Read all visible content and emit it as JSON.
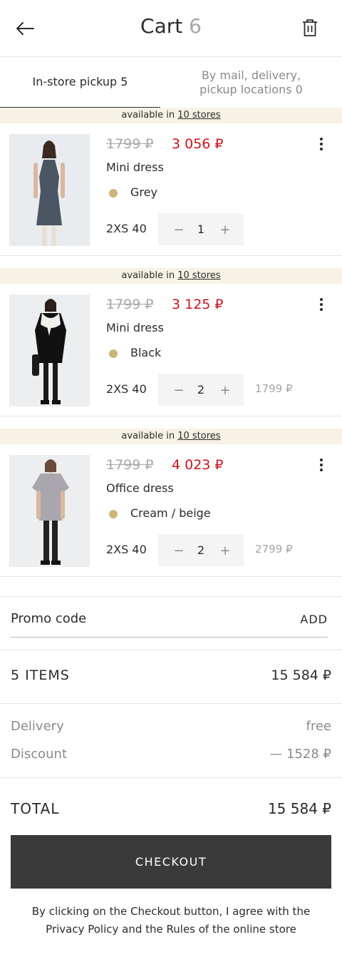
{
  "header": {
    "title": "Cart",
    "count": "6"
  },
  "tabs": [
    {
      "label": "In-store pickup 5"
    },
    {
      "label": "By mail, delivery, pickup locations 0"
    }
  ],
  "store_strip": {
    "prefix": "available in",
    "link": "10 stores"
  },
  "items": [
    {
      "old_price": "1799 ₽",
      "new_price": "3 056 ₽",
      "name": "Mini dress",
      "color": "Grey",
      "size": "2XS 40",
      "quantity": "1",
      "unit_price": ""
    },
    {
      "old_price": "1799 ₽",
      "new_price": "3 125 ₽",
      "name": "Mini dress",
      "color": "Black",
      "size": "2XS 40",
      "quantity": "2",
      "unit_price": "1799 ₽"
    },
    {
      "old_price": "1799 ₽",
      "new_price": "4 023 ₽",
      "name": "Office dress",
      "color": "Cream / beige",
      "size": "2XS 40",
      "quantity": "2",
      "unit_price": "2799 ₽"
    }
  ],
  "stepper": {
    "minus": "−",
    "plus": "+"
  },
  "promo": {
    "label": "Promo code",
    "add": "ADD"
  },
  "summary": {
    "items_label": "5 ITEMS",
    "items_value": "15 584 ₽",
    "delivery_label": "Delivery",
    "delivery_value": "free",
    "discount_label": "Discount",
    "discount_value": "— 1528 ₽",
    "total_label": "TOTAL",
    "total_value": "15 584 ₽"
  },
  "checkout": {
    "label": "CHECKOUT",
    "agreement": "By clicking on the Checkout button, I agree with the Privacy Policy and the Rules of the online store"
  },
  "colors": {
    "accent_price": "#d0131a",
    "strip_bg": "#f6f2e6",
    "color_dot": "#cfb47a",
    "checkout_bg": "#3a3a3a"
  },
  "icons": {
    "back": "arrow-left-icon",
    "trash": "trash-icon",
    "more": "more-vertical-icon"
  }
}
